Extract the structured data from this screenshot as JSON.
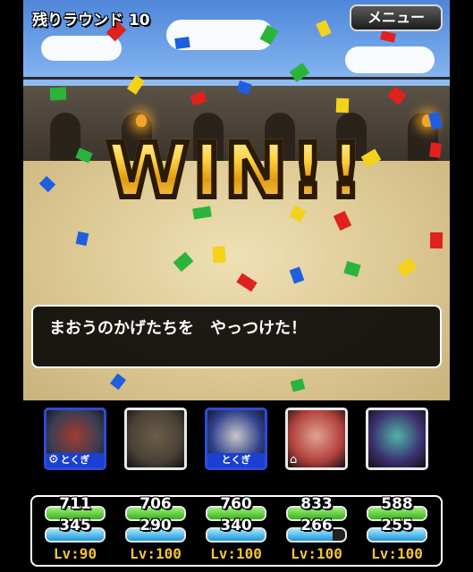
{
  "header": {
    "round_text": "残りラウンド 10",
    "menu_label": "メニュー"
  },
  "banner": {
    "text": "WIN!!"
  },
  "message": {
    "text": "まおうのかげたちを　やっつけた！"
  },
  "party": [
    {
      "name": "party-slot-1",
      "tag": "とくぎ",
      "selected": true,
      "icon": "gear-icon",
      "hp": 711,
      "mp": 345,
      "level": "Lv:90",
      "hp_fill": 1.0,
      "mp_fill": 1.0,
      "colors": [
        "#3a3d55",
        "#a33b2f"
      ]
    },
    {
      "name": "party-slot-2",
      "tag": "",
      "selected": false,
      "icon": "",
      "hp": 706,
      "mp": 290,
      "level": "Lv:100",
      "hp_fill": 1.0,
      "mp_fill": 1.0,
      "colors": [
        "#4a4236",
        "#6c5d48"
      ]
    },
    {
      "name": "party-slot-3",
      "tag": "とくぎ",
      "selected": true,
      "icon": "",
      "hp": 760,
      "mp": 340,
      "level": "Lv:100",
      "hp_fill": 1.0,
      "mp_fill": 1.0,
      "colors": [
        "#2f3f8a",
        "#c7c7c7"
      ]
    },
    {
      "name": "party-slot-4",
      "tag": "",
      "selected": false,
      "icon": "home-icon",
      "hp": 833,
      "mp": 266,
      "level": "Lv:100",
      "hp_fill": 1.0,
      "mp_fill": 0.78,
      "colors": [
        "#b1423d",
        "#e1a394"
      ]
    },
    {
      "name": "party-slot-5",
      "tag": "",
      "selected": false,
      "icon": "",
      "hp": 588,
      "mp": 255,
      "level": "Lv:100",
      "hp_fill": 1.0,
      "mp_fill": 1.0,
      "colors": [
        "#3c2f6e",
        "#4fb3a9"
      ]
    }
  ]
}
